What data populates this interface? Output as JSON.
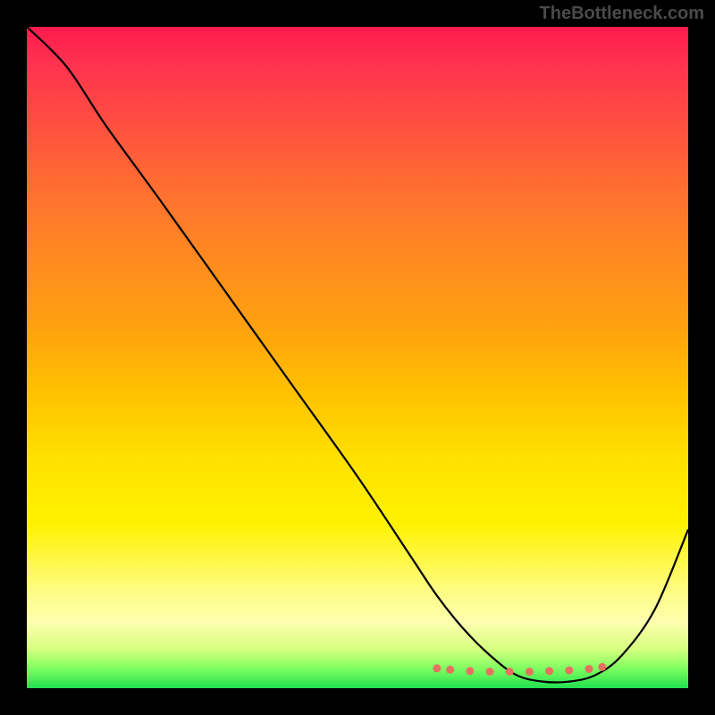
{
  "attribution": "TheBottleneck.com",
  "chart_data": {
    "type": "line",
    "title": "",
    "xlabel": "",
    "ylabel": "",
    "xlim": [
      0,
      100
    ],
    "ylim": [
      0,
      100
    ],
    "series": [
      {
        "name": "bottleneck-curve",
        "x": [
          0,
          6,
          12,
          20,
          30,
          40,
          50,
          58,
          62,
          66,
          70,
          74,
          78,
          82,
          86,
          90,
          95,
          100
        ],
        "y": [
          100,
          94,
          85,
          74,
          60,
          46,
          32,
          20,
          14,
          9,
          5,
          2,
          1,
          1,
          2,
          5,
          12,
          24
        ]
      }
    ],
    "markers": {
      "name": "recommended-range",
      "x": [
        62,
        64,
        67,
        70,
        73,
        76,
        79,
        82,
        85,
        87
      ],
      "y": [
        3,
        2.8,
        2.6,
        2.5,
        2.5,
        2.5,
        2.6,
        2.7,
        2.9,
        3.2
      ]
    },
    "gradient_stops": [
      {
        "pos": 0,
        "color": "#ff1a4d"
      },
      {
        "pos": 50,
        "color": "#ffc800"
      },
      {
        "pos": 90,
        "color": "#fdffb0"
      },
      {
        "pos": 100,
        "color": "#20e050"
      }
    ]
  }
}
